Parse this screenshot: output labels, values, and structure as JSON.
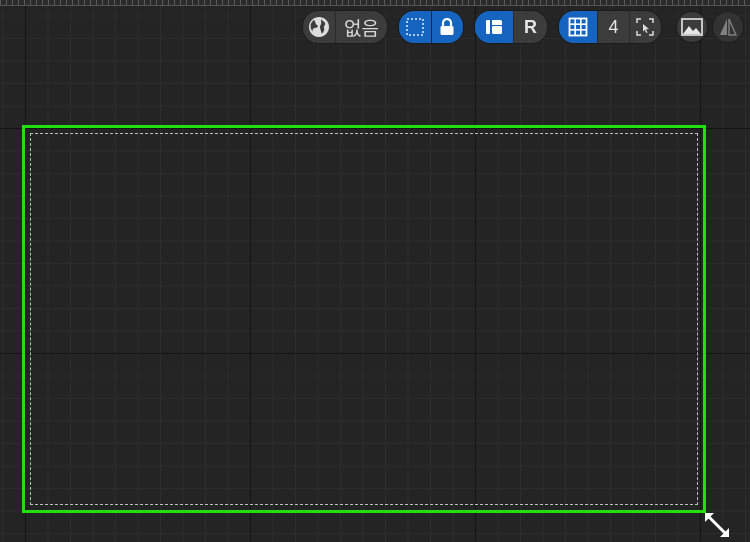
{
  "toolbar": {
    "world_space": {
      "icon": "globe-icon",
      "value_label": "없음"
    },
    "selection_group": {
      "marquee_icon": "dotted-square-icon",
      "lock_icon": "lock-icon",
      "state": "both active"
    },
    "rotation_group": {
      "icon": "rotate-snap-icon",
      "value_label": "R"
    },
    "grid_group": {
      "icon": "grid-icon",
      "value_label": "4"
    },
    "extra_buttons": [
      {
        "icon": "cursor-select-icon"
      },
      {
        "icon": "image-preview-icon"
      },
      {
        "icon": "mirror-icon"
      }
    ]
  },
  "canvas": {
    "background_color": "#242424",
    "grid": true,
    "selection_color": "#22e010",
    "safe_area_color": "#bdbdbd",
    "resize_handle_icon": "resize-diagonal-icon"
  }
}
